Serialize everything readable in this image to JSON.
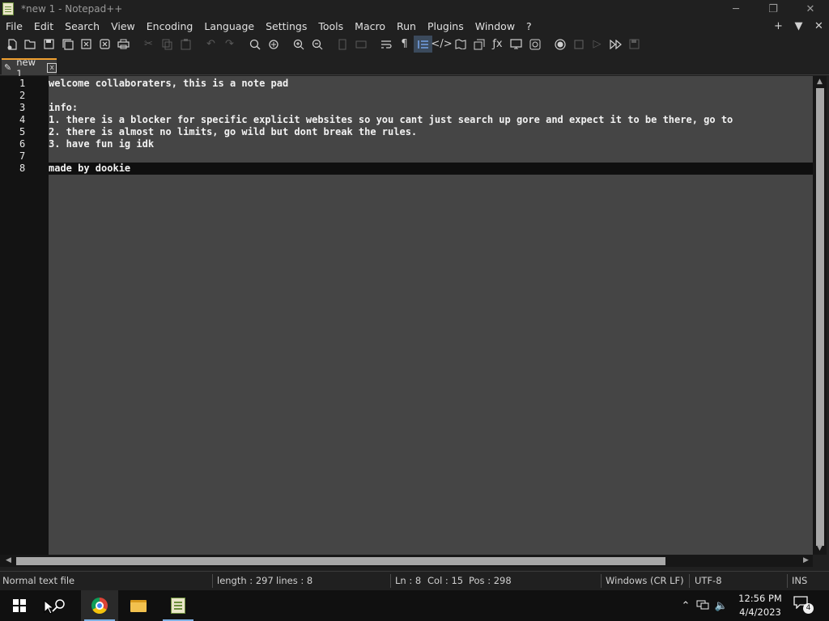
{
  "window": {
    "title": "*new 1 - Notepad++",
    "minimize": "─",
    "restore": "❐",
    "close": "✕"
  },
  "menu": {
    "items": [
      "File",
      "Edit",
      "Search",
      "View",
      "Encoding",
      "Language",
      "Settings",
      "Tools",
      "Macro",
      "Run",
      "Plugins",
      "Window",
      "?"
    ],
    "right": {
      "add": "+",
      "dropdown": "▼",
      "close": "✕"
    }
  },
  "toolbar": {
    "icons": [
      "new-file",
      "open-file",
      "save",
      "save-all",
      "close",
      "close-all",
      "print",
      "cut",
      "copy",
      "paste",
      "undo",
      "redo",
      "find",
      "replace",
      "zoom-in",
      "zoom-out",
      "sync-vertical",
      "sync-horizontal",
      "word-wrap",
      "show-all-characters",
      "indent-guide",
      "user-defined-language",
      "document-map",
      "document-list",
      "function-list",
      "folder-as-workspace",
      "monitoring",
      "record-macro",
      "stop-recording",
      "playback",
      "run-macro-multiple",
      "save-macro"
    ]
  },
  "tab": {
    "label": "new 1",
    "close": "x"
  },
  "editor": {
    "line_numbers": [
      "1",
      "2",
      "3",
      "4",
      "5",
      "6",
      "7",
      "8"
    ],
    "lines": [
      "welcome collaboraters, this is a note pad",
      "",
      "info:",
      "1. there is a blocker for specific explicit websites so you cant just search up gore and expect it to be there, go to",
      "2. there is almost no limits, go wild but dont break the rules.",
      "3. have fun ig idk",
      "",
      "made by dookie"
    ],
    "current_line": 8
  },
  "status": {
    "file_type": "Normal text file",
    "length": "length : 297",
    "lines": "lines : 8",
    "ln": "Ln : 8",
    "col": "Col : 15",
    "pos": "Pos : 298",
    "eol": "Windows (CR LF)",
    "encoding": "UTF-8",
    "mode": "INS"
  },
  "taskbar": {
    "time": "12:56 PM",
    "date": "4/4/2023",
    "notifications": "4"
  },
  "colors": {
    "accent_tab": "#f0a030",
    "editor_bg": "#454545",
    "gutter_bg": "#131313"
  }
}
